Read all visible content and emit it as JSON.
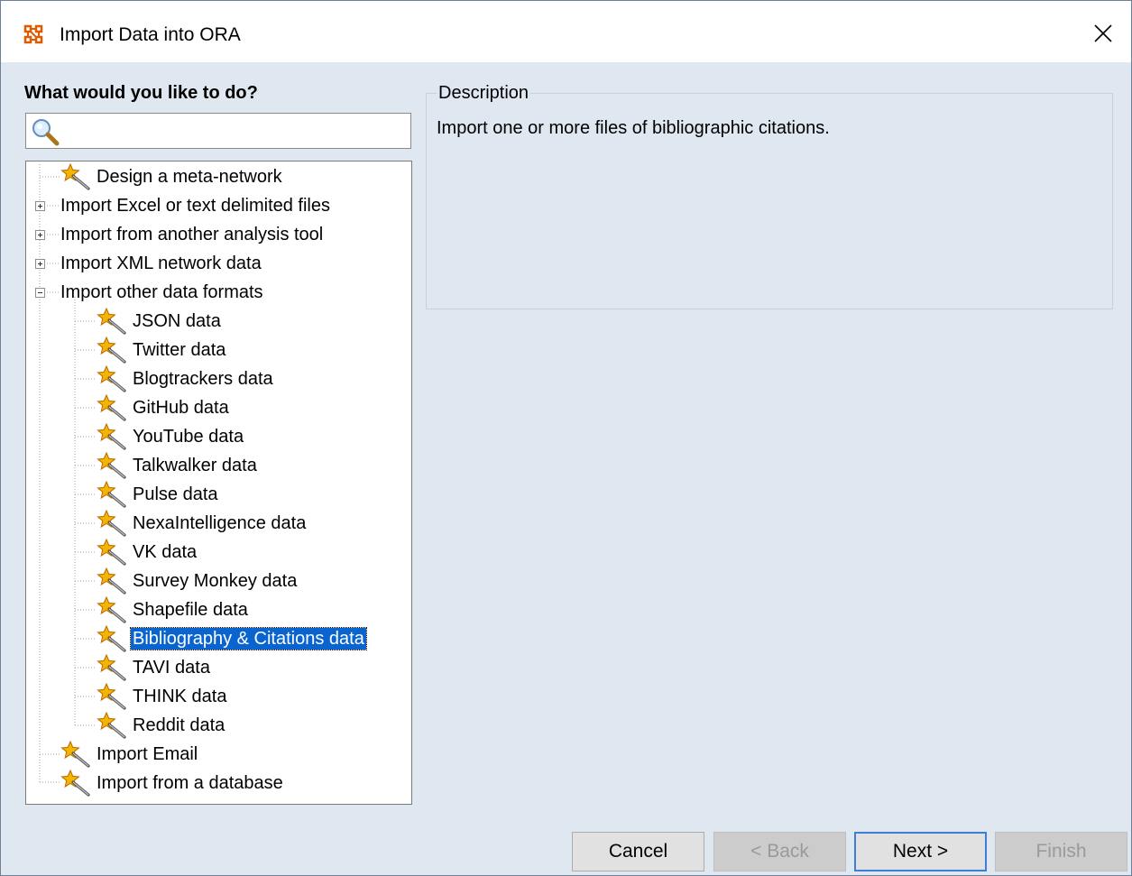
{
  "window": {
    "title": "Import Data into ORA",
    "close_glyph": "✕",
    "app_icon": "ora-network-icon"
  },
  "left_panel": {
    "heading": "What would you like to do?",
    "search": {
      "value": "",
      "placeholder": "",
      "icon": "search-icon"
    }
  },
  "tree": {
    "items": [
      {
        "label": "Design a meta-network",
        "icon": "wand-icon"
      },
      {
        "label": "Import Excel or text delimited files",
        "expander": "collapsed"
      },
      {
        "label": "Import from another analysis tool",
        "expander": "collapsed"
      },
      {
        "label": "Import XML network data",
        "expander": "collapsed"
      },
      {
        "label": "Import other data formats",
        "expander": "expanded",
        "children": [
          {
            "label": "JSON data",
            "icon": "wand-icon"
          },
          {
            "label": "Twitter data",
            "icon": "wand-icon"
          },
          {
            "label": "Blogtrackers data",
            "icon": "wand-icon"
          },
          {
            "label": "GitHub data",
            "icon": "wand-icon"
          },
          {
            "label": "YouTube data",
            "icon": "wand-icon"
          },
          {
            "label": "Talkwalker data",
            "icon": "wand-icon"
          },
          {
            "label": "Pulse data",
            "icon": "wand-icon"
          },
          {
            "label": "NexaIntelligence data",
            "icon": "wand-icon"
          },
          {
            "label": "VK data",
            "icon": "wand-icon"
          },
          {
            "label": "Survey Monkey data",
            "icon": "wand-icon"
          },
          {
            "label": "Shapefile data",
            "icon": "wand-icon"
          },
          {
            "label": "Bibliography & Citations data",
            "icon": "wand-icon",
            "selected": true
          },
          {
            "label": "TAVI data",
            "icon": "wand-icon"
          },
          {
            "label": "THINK data",
            "icon": "wand-icon"
          },
          {
            "label": "Reddit data",
            "icon": "wand-icon"
          }
        ]
      },
      {
        "label": "Import Email",
        "icon": "wand-icon"
      },
      {
        "label": "Import from a database",
        "icon": "wand-icon"
      }
    ]
  },
  "description": {
    "title": "Description",
    "text": "Import one or more files of bibliographic citations."
  },
  "buttons": {
    "cancel": {
      "label": "Cancel",
      "mnemonic": "C",
      "enabled": true
    },
    "back": {
      "label": "< Back",
      "mnemonic": "B",
      "enabled": false
    },
    "next": {
      "label": "Next >",
      "mnemonic": "N",
      "enabled": true,
      "default": true
    },
    "finish": {
      "label": "Finish",
      "mnemonic": "i",
      "enabled": false
    }
  },
  "colors": {
    "background": "#dfe7f0",
    "selection": "#0a64d0",
    "wand_star": "#f5b400",
    "app_icon": "#e05a00"
  }
}
